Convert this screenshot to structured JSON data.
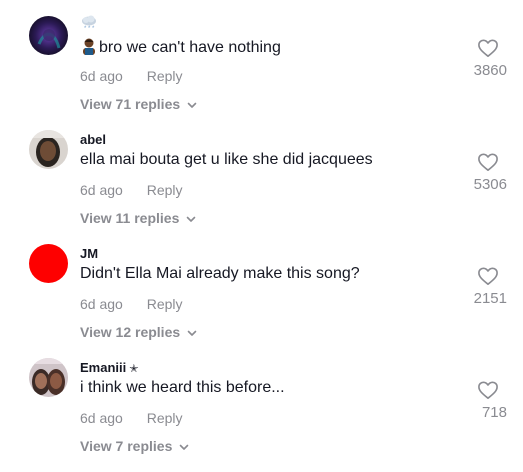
{
  "comments": [
    {
      "username": "",
      "text": "bro we can't have nothing",
      "time": "6d ago",
      "reply": "Reply",
      "replies": "View 71 replies",
      "likes": "3860"
    },
    {
      "username": "abel",
      "text": "ella mai bouta get u like she did jacquees",
      "time": "6d ago",
      "reply": "Reply",
      "replies": "View 11 replies",
      "likes": "5306"
    },
    {
      "username": "JM",
      "text": "Didn't Ella Mai already make this song?",
      "time": "6d ago",
      "reply": "Reply",
      "replies": "View 12 replies",
      "likes": "2151"
    },
    {
      "username": "Emaniii",
      "text": "i think we heard this before...",
      "time": "6d ago",
      "reply": "Reply",
      "replies": "View 7 replies",
      "likes": "718"
    }
  ],
  "colors": {
    "meta_gray": "#8a8b91",
    "text_dark": "#161823",
    "red_avatar": "#fe0000"
  },
  "icons": {
    "like": "heart-outline-icon",
    "expand": "chevron-down-icon",
    "badge": "star-icon"
  }
}
